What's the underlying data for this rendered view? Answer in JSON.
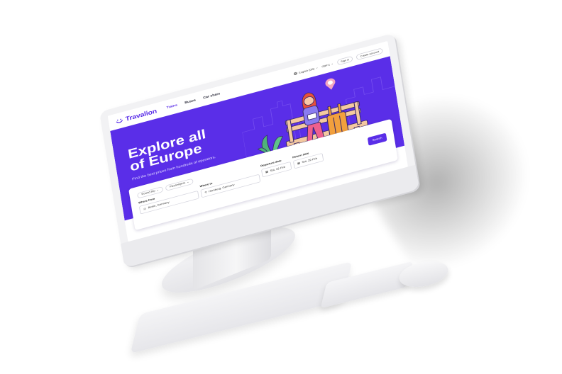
{
  "brand": {
    "name": "Travalion",
    "accent": "#5a2ee8",
    "icon": "smile-logo-icon"
  },
  "nav": {
    "links": [
      "Trains",
      "Buses",
      "Car share"
    ],
    "active": "Trains",
    "language": "English (GB)",
    "currency": "GBP £",
    "sign_in": "Sign in",
    "create_account": "Create account"
  },
  "hero": {
    "title_line1": "Explore all",
    "title_line2": "of Europe",
    "subtitle": "Find the best prices from hundreds of operators."
  },
  "search": {
    "trip_type": "Round trip",
    "passengers": "Passengers",
    "where_from_label": "Where from",
    "where_from_value": "Berlin, Germany",
    "where_to_label": "Where to",
    "where_to_value": "Hamburg, Germany",
    "departure_label": "Departure date",
    "departure_value": "Sat, 22 Feb",
    "return_label": "Return date",
    "return_value": "Sat, 29 Feb",
    "button": "Search"
  }
}
